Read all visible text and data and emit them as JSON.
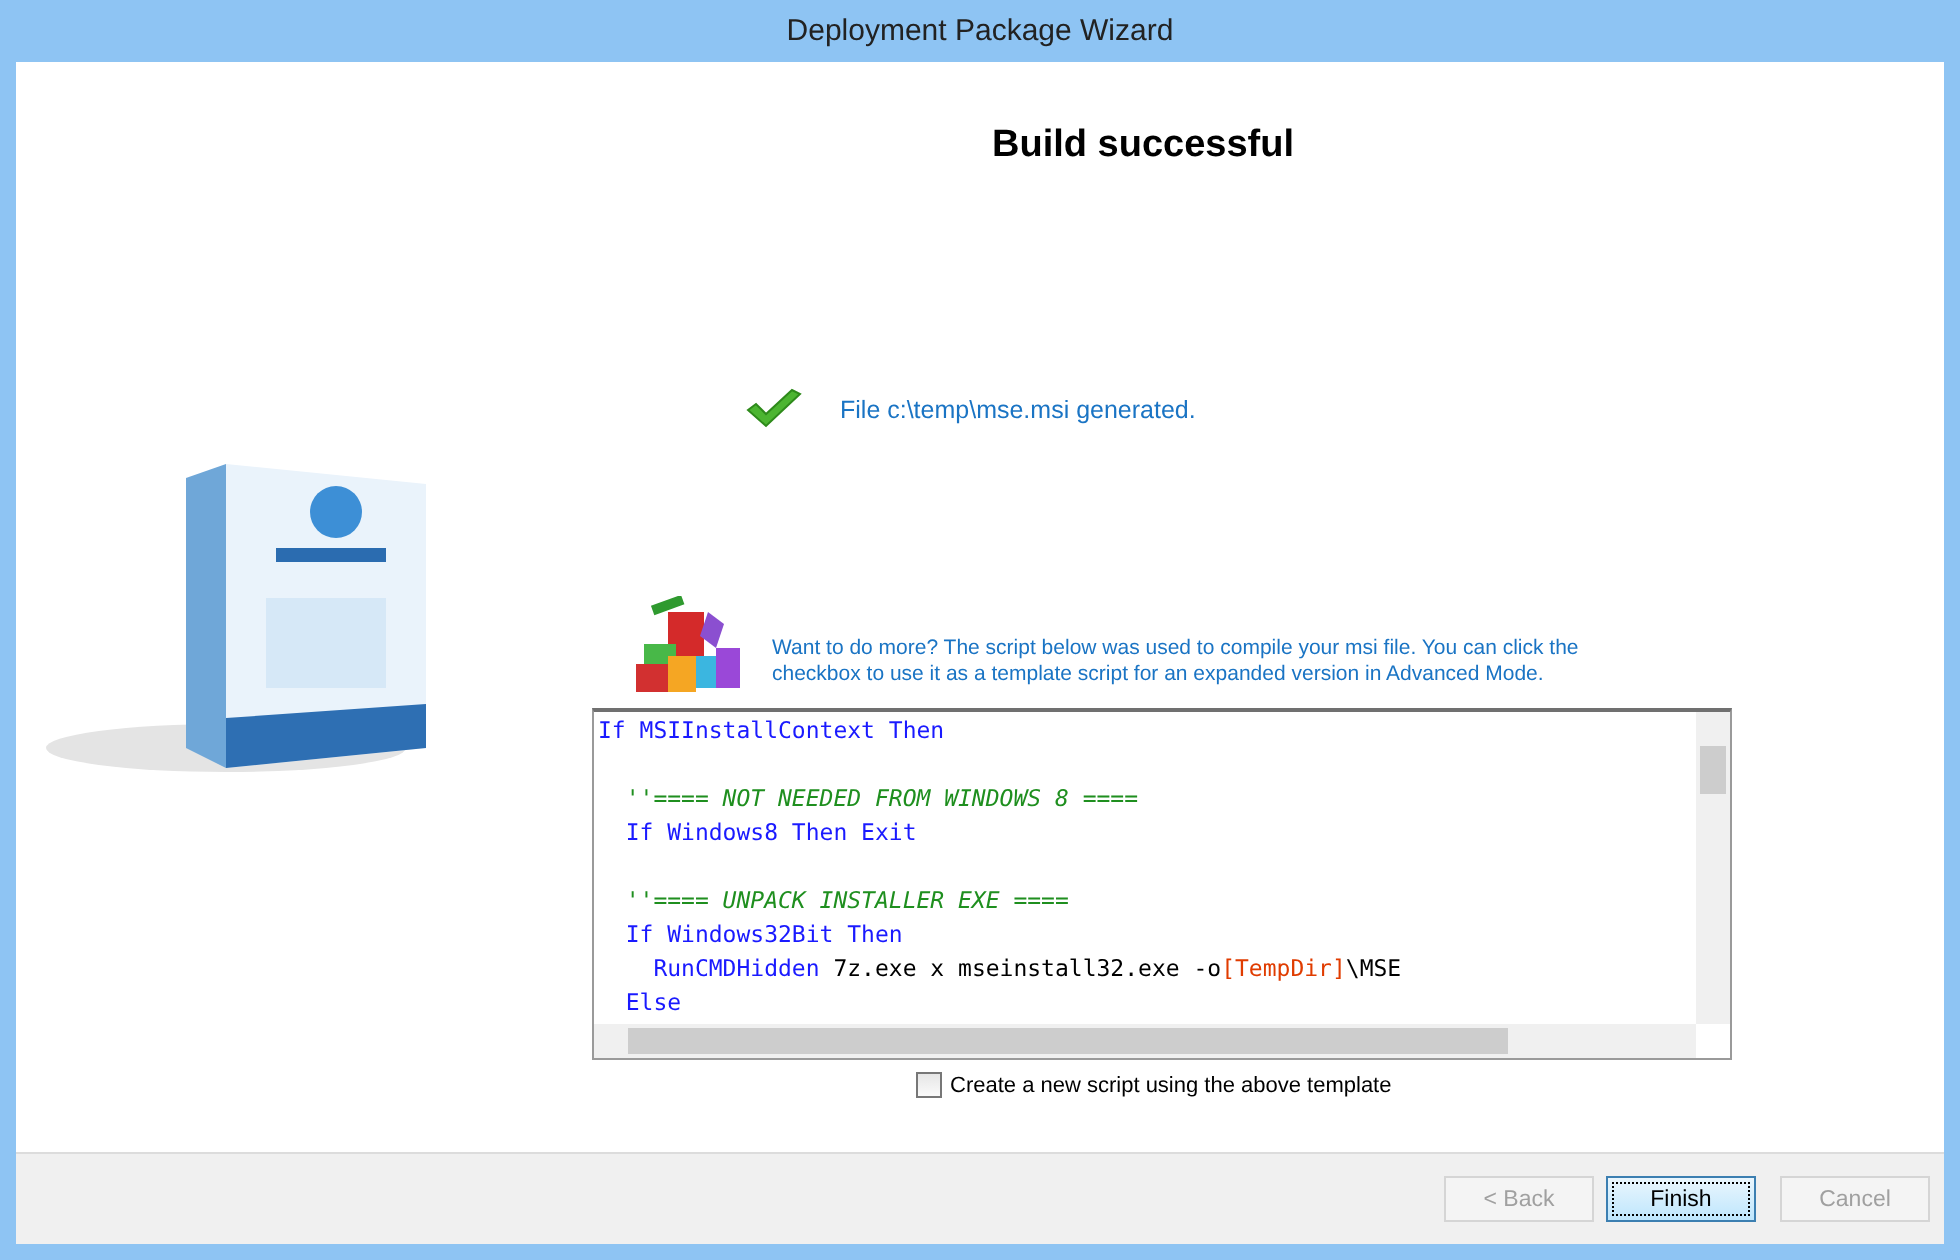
{
  "window": {
    "title": "Deployment Package Wizard"
  },
  "heading": "Build successful",
  "result": {
    "message": "File c:\\temp\\mse.msi generated."
  },
  "info": {
    "text": "Want to do more? The script below was used to compile your msi file. You can click the checkbox to use it as a template script for an expanded version in Advanced Mode."
  },
  "script_lines": [
    {
      "kind": "code",
      "tokens": [
        {
          "kind": "keyword",
          "text": "If MSIInstallContext Then"
        }
      ]
    },
    {
      "kind": "blank"
    },
    {
      "kind": "code",
      "tokens": [
        {
          "kind": "comment",
          "text": "  ''==== NOT NEEDED FROM WINDOWS 8 ===="
        }
      ]
    },
    {
      "kind": "code",
      "tokens": [
        {
          "kind": "keyword",
          "text": "  If Windows8 Then Exit"
        }
      ]
    },
    {
      "kind": "blank"
    },
    {
      "kind": "code",
      "tokens": [
        {
          "kind": "comment",
          "text": "  ''==== UNPACK INSTALLER EXE ===="
        }
      ]
    },
    {
      "kind": "code",
      "tokens": [
        {
          "kind": "keyword",
          "text": "  If Windows32Bit Then"
        }
      ]
    },
    {
      "kind": "code",
      "tokens": [
        {
          "kind": "keyword",
          "text": "    RunCMDHidden"
        },
        {
          "kind": "plain",
          "text": " 7z.exe x mseinstall32.exe -o"
        },
        {
          "kind": "variable",
          "text": "[TempDir]"
        },
        {
          "kind": "plain",
          "text": "\\MSE"
        }
      ]
    },
    {
      "kind": "code",
      "tokens": [
        {
          "kind": "keyword",
          "text": "  Else"
        }
      ]
    }
  ],
  "template_checkbox": {
    "label": "Create a new script using the above template",
    "checked": false
  },
  "buttons": [
    {
      "label": "< Back",
      "disabled": true,
      "default": false
    },
    {
      "label": "Finish",
      "disabled": false,
      "default": true
    },
    {
      "label": "Cancel",
      "disabled": true,
      "default": false
    }
  ]
}
